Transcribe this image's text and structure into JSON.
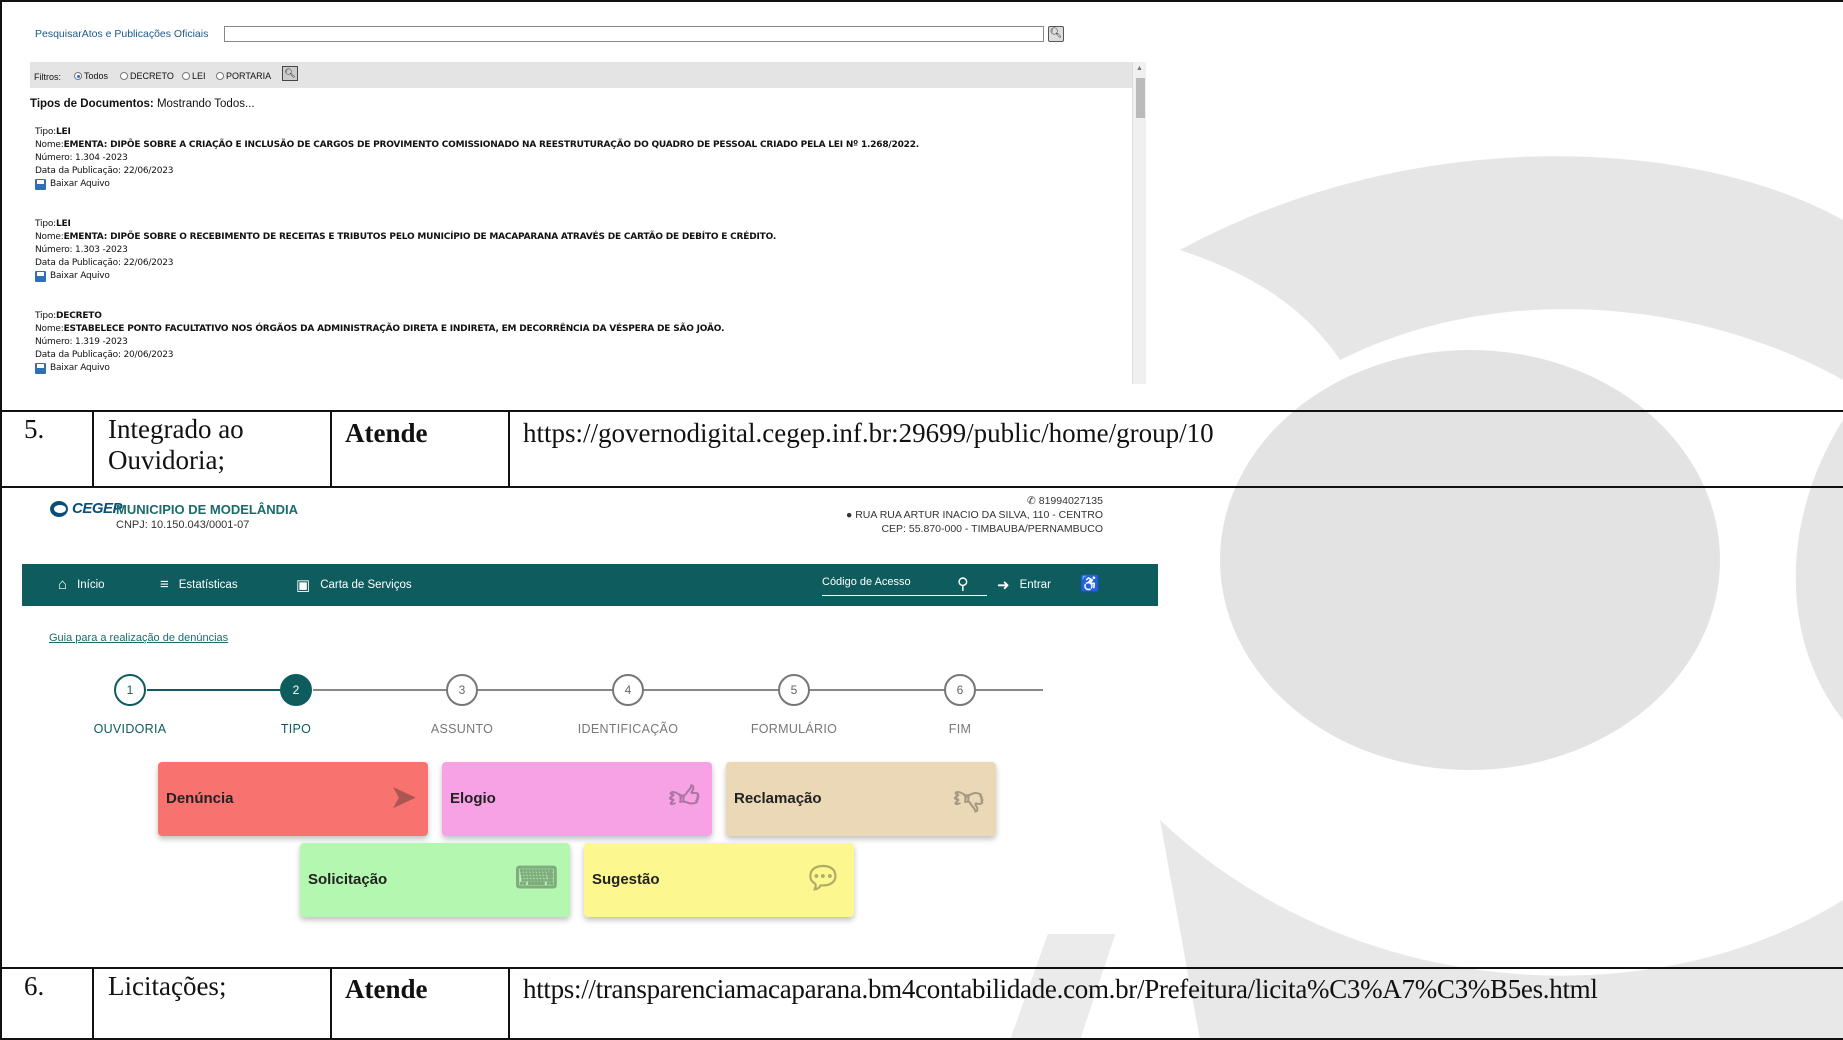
{
  "screenshot1": {
    "search_label": "PesquisarAtos e Publicações Oficiais",
    "filter_label": "Filtros:",
    "filters": [
      "Todos",
      "DECRETO",
      "LEI",
      "PORTARIA"
    ],
    "doc_types_label": "Tipos de Documentos:",
    "doc_types_value": "Mostrando Todos...",
    "entries": [
      {
        "tipo_label": "Tipo:",
        "tipo": "LEI",
        "nome_label": "Nome:",
        "nome": "EMENTA: DIPÕE SOBRE A CRIAÇÃO E INCLUSÃO DE CARGOS DE PROVIMENTO COMISSIONADO NA REESTRUTURAÇÃO DO QUADRO DE PESSOAL CRIADO PELA LEI Nº 1.268/2022.",
        "numero": "Número: 1.304 -2023",
        "data": "Data da Publicação: 22/06/2023",
        "baixar": "Baixar Aquivo"
      },
      {
        "tipo_label": "Tipo:",
        "tipo": "LEI",
        "nome_label": "Nome:",
        "nome": "EMENTA: DIPÕE SOBRE O RECEBIMENTO DE RECEITAS E TRIBUTOS PELO MUNICÍPIO DE MACAPARANA ATRAVÉS DE CARTÃO DE DEBÍTO E CRÉDITO.",
        "numero": "Número: 1.303 -2023",
        "data": "Data da Publicação: 22/06/2023",
        "baixar": "Baixar Aquivo"
      },
      {
        "tipo_label": "Tipo:",
        "tipo": "DECRETO",
        "nome_label": "Nome:",
        "nome": "ESTABELECE PONTO FACULTATIVO NOS ÓRGÃOS DA ADMINISTRAÇÃO DIRETA E INDIRETA, EM DECORRÊNCIA DA VÉSPERA DE SÃO JOÃO.",
        "numero": "Número: 1.319 -2023",
        "data": "Data da Publicação: 20/06/2023",
        "baixar": "Baixar Aquivo"
      }
    ]
  },
  "rows": [
    {
      "num": "5.",
      "item": "Integrado ao Ouvidoria;",
      "status": "Atende",
      "url": "https://governodigital.cegep.inf.br:29699/public/home/group/10"
    },
    {
      "num": "6.",
      "item": "Licitações;",
      "status": "Atende",
      "url": "https://transparenciamacaparana.bm4contabilidade.com.br/Prefeitura/licita%C3%A7%C3%B5es.html"
    }
  ],
  "screenshot2": {
    "logo_text": "CEGEP",
    "municipio": "MUNICIPIO DE MODELÂNDIA",
    "cnpj": "CNPJ: 10.150.043/0001-07",
    "phone": "81994027135",
    "address1": "RUA RUA ARTUR INACIO DA SILVA, 110 - CENTRO",
    "address2": "CEP: 55.870-000 - TIMBAUBA/PERNAMBUCO",
    "nav": {
      "inicio": "Início",
      "estatisticas": "Estatísticas",
      "carta": "Carta de Serviços",
      "codigo_placeholder": "Código de Acesso",
      "entrar": "Entrar"
    },
    "guide_link": "Guia para a realização de denúncias",
    "steps": [
      {
        "n": "1",
        "label": "OUVIDORIA"
      },
      {
        "n": "2",
        "label": "TIPO"
      },
      {
        "n": "3",
        "label": "ASSUNTO"
      },
      {
        "n": "4",
        "label": "IDENTIFICAÇÃO"
      },
      {
        "n": "5",
        "label": "FORMULÁRIO"
      },
      {
        "n": "6",
        "label": "FIM"
      }
    ],
    "cards": [
      {
        "label": "Denúncia",
        "color": "#f8736f",
        "icon": "megaphone-icon"
      },
      {
        "label": "Elogio",
        "color": "#f8a2e6",
        "icon": "thumbs-up-icon"
      },
      {
        "label": "Reclamação",
        "color": "#ead8b6",
        "icon": "thumbs-down-icon"
      },
      {
        "label": "Solicitação",
        "color": "#b3f7b1",
        "icon": "keyboard-icon"
      },
      {
        "label": "Sugestão",
        "color": "#fdf78f",
        "icon": "chat-icon"
      }
    ],
    "accent_color": "#0e5c5e"
  }
}
